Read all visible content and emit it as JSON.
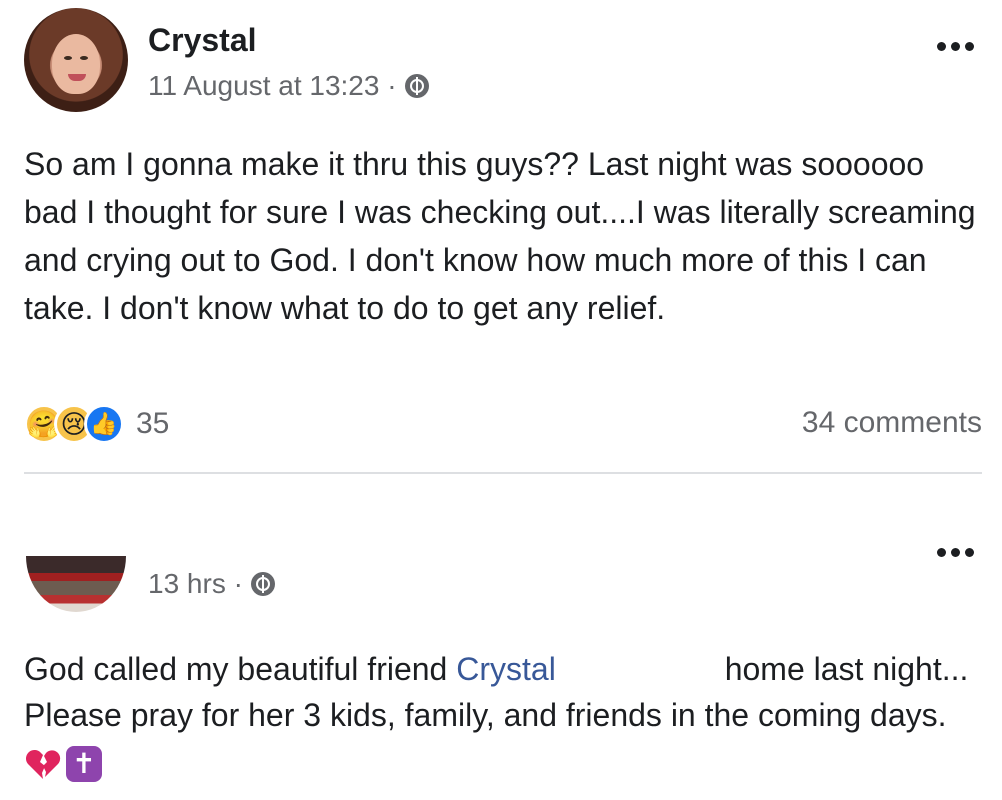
{
  "post1": {
    "author": "Crystal",
    "timestamp": "11 August at 13:23 ·",
    "privacy_icon": "globe-icon",
    "body": "So am I gonna make it thru this guys?? Last night was soooooo bad I thought for sure I was checking out....I was literally screaming and crying out to God. I don't know how much more of this I can take. I don't know what to do to get any relief.",
    "reactions": {
      "icons": [
        "care-icon",
        "sad-icon",
        "like-icon"
      ],
      "count": "35"
    },
    "comments": "34 comments",
    "more_icon": "more-options-icon"
  },
  "post2": {
    "timestamp": "13 hrs ·",
    "privacy_icon": "globe-icon",
    "body_part1": "God called my beautiful friend ",
    "mention": "Crystal",
    "body_part2": " home last night... Please pray for her 3 kids, family, and friends in the coming days.",
    "emojis": [
      "broken-heart-icon",
      "latin-cross-icon"
    ],
    "more_icon": "more-options-icon"
  },
  "colors": {
    "text": "#1c1e21",
    "secondary": "#65676b",
    "link": "#385898",
    "like_blue": "#1877f2",
    "divider": "#dddfe2"
  }
}
